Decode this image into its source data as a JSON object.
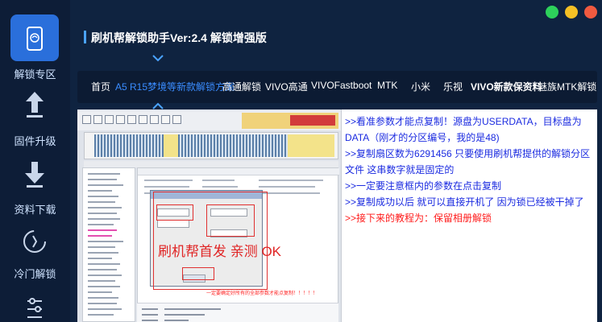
{
  "app": {
    "title": "刷机帮解锁助手Ver:2.4 解锁增强版"
  },
  "window_controls": {
    "green": "#2dd15b",
    "yellow": "#f5c025",
    "red": "#f05a40"
  },
  "sidebar": {
    "items": [
      {
        "label": "解锁专区",
        "icon": "phone-lock-icon",
        "active": true
      },
      {
        "label": "固件升级",
        "icon": "upload-arrow-icon",
        "active": false
      },
      {
        "label": "资料下载",
        "icon": "download-arrow-icon",
        "active": false
      },
      {
        "label": "冷门解锁",
        "icon": "refresh-circle-icon",
        "active": false
      },
      {
        "label": "",
        "icon": "settings-sliders-icon",
        "active": false
      }
    ]
  },
  "nav": {
    "tabs": [
      {
        "label": "首页",
        "active": false
      },
      {
        "label": "A5 R15梦境等新款解锁方案",
        "active": true
      },
      {
        "label": "高通解锁",
        "active": false
      },
      {
        "label": "VIVO高通",
        "active": false
      },
      {
        "label": "VIVOFastboot",
        "active": false
      },
      {
        "label": "MTK",
        "active": false
      },
      {
        "label": "小米",
        "active": false
      },
      {
        "label": "乐视",
        "active": false
      },
      {
        "label": "VIVO新款保资料",
        "active": false,
        "bold": true
      },
      {
        "label": "魅族MTK解锁",
        "active": false
      }
    ]
  },
  "screenshot": {
    "handwritten_label": "刷机帮首发 亲测 OK",
    "red_note": "一定要确定好所有的全部参数才能点复制！！！！！"
  },
  "instructions": [
    {
      "text": ">>看准参数才能点复制！源盘为USERDATA，目标盘为DATA（刚才的分区编号，我的是48)",
      "color": "blue"
    },
    {
      "text": ">>复制扇区数为6291456 只要使用刷机帮提供的解锁分区文件 这串数字就是固定的",
      "color": "blue"
    },
    {
      "text": ">>一定要注意框内的参数在点击复制",
      "color": "blue"
    },
    {
      "text": ">>复制成功以后 就可以直接开机了 因为锁已经被干掉了",
      "color": "blue"
    },
    {
      "text": ">>接下来的教程为：保留相册解锁",
      "color": "red"
    }
  ],
  "colors": {
    "sidebar_bg": "#0d1d37",
    "accent": "#2a6fdb",
    "nav_active": "#3a8cff",
    "note_blue": "#1a2ae0",
    "note_red": "#ff1b1b"
  }
}
